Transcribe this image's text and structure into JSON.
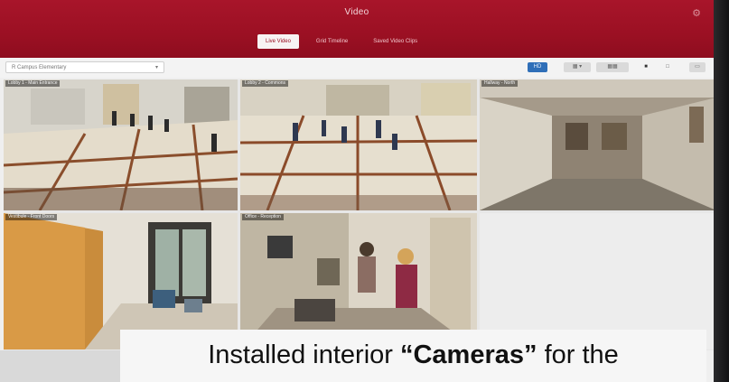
{
  "app": {
    "title": "Video",
    "settings_icon": "gear-icon"
  },
  "tabs": [
    {
      "label": "Live Video",
      "active": true
    },
    {
      "label": "Grid Timeline",
      "active": false
    },
    {
      "label": "Saved Video Clips",
      "active": false
    }
  ],
  "toolbar": {
    "site_select_value": "R Campus Elementary",
    "site_select_icon": "chevron-down-icon",
    "grid_button_label": "HD",
    "layout_icons": [
      "grid-4-icon",
      "grid-9-icon",
      "square-icon",
      "fullscreen-icon",
      "layout-icon"
    ]
  },
  "cameras": [
    {
      "label": "Lobby 1 - Main Entrance",
      "scene": "lobby"
    },
    {
      "label": "Lobby 2 - Commons",
      "scene": "lobby"
    },
    {
      "label": "Hallway - North",
      "scene": "hallway"
    },
    {
      "label": "Vestibule - Front Doors",
      "scene": "vestibule"
    },
    {
      "label": "Office - Reception",
      "scene": "office"
    },
    {
      "label": "",
      "scene": "empty"
    }
  ],
  "caption": {
    "before": "Installed interior ",
    "bold": "“Cameras”",
    "after": " for the"
  },
  "colors": {
    "header": "#9b1023",
    "accent": "#2f6fb8",
    "background": "#efefef"
  }
}
